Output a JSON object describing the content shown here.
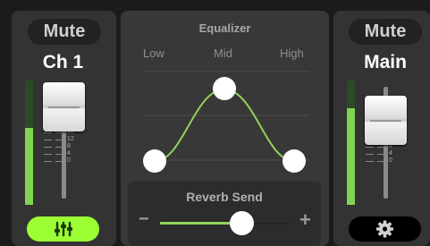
{
  "channels": {
    "left": {
      "mute_label": "Mute",
      "name": "Ch 1",
      "meter_level_fraction": 0.62,
      "fader_level_fraction": 0.79,
      "scale": [
        "32",
        "28",
        "24",
        "20",
        "16",
        "12",
        "8",
        "4",
        "0"
      ],
      "footer_icon": "mixer-sliders-icon"
    },
    "right": {
      "mute_label": "Mute",
      "name": "Main",
      "meter_level_fraction": 0.78,
      "fader_level_fraction": 0.72,
      "scale": [
        "32",
        "28",
        "24",
        "20",
        "16",
        "12",
        "8",
        "4",
        "0"
      ],
      "footer_icon": "gear-icon"
    }
  },
  "equalizer": {
    "title": "Equalizer",
    "bands": [
      "Low",
      "Mid",
      "High"
    ]
  },
  "reverb": {
    "title": "Reverb Send",
    "minus_label": "−",
    "plus_label": "+",
    "value_fraction": 0.64
  },
  "colors": {
    "accent_green": "#9bff33",
    "curve_green": "#8fd45a",
    "meter_green": "#7fd451",
    "panel": "#333333",
    "background": "#1b1b1b"
  }
}
